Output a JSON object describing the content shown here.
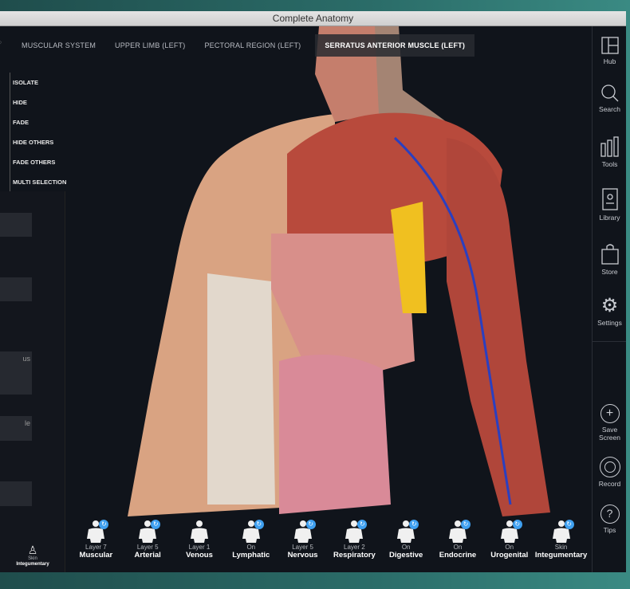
{
  "window": {
    "title": "Complete Anatomy"
  },
  "breadcrumbs": [
    "MUSCULAR SYSTEM",
    "UPPER LIMB (LEFT)",
    "PECTORAL REGION (LEFT)",
    "SERRATUS ANTERIOR MUSCLE (LEFT)"
  ],
  "context_menu": [
    "ISOLATE",
    "HIDE",
    "FADE",
    "HIDE OTHERS",
    "FADE OTHERS",
    "MULTI SELECTION"
  ],
  "left_panel": {
    "fragments": [
      "us",
      "le"
    ]
  },
  "right_sidebar": [
    {
      "label": "Hub",
      "icon": "hub-icon"
    },
    {
      "label": "Search",
      "icon": "search-icon"
    },
    {
      "label": "Tools",
      "icon": "tools-icon"
    },
    {
      "label": "Library",
      "icon": "library-icon"
    },
    {
      "label": "Store",
      "icon": "store-icon"
    },
    {
      "label": "Settings",
      "icon": "gear-icon"
    }
  ],
  "right_actions": [
    {
      "label": "Save Screen",
      "icon": "plus-icon"
    },
    {
      "label": "Record",
      "icon": "record-icon"
    },
    {
      "label": "Tips",
      "icon": "help-icon"
    }
  ],
  "systems": [
    {
      "layer": "Layer 7",
      "name": "Muscular",
      "badge": true
    },
    {
      "layer": "Layer 5",
      "name": "Arterial",
      "badge": true
    },
    {
      "layer": "Layer 1",
      "name": "Venous",
      "badge": false
    },
    {
      "layer": "On",
      "name": "Lymphatic",
      "badge": true
    },
    {
      "layer": "Layer 5",
      "name": "Nervous",
      "badge": true
    },
    {
      "layer": "Layer 2",
      "name": "Respiratory",
      "badge": true
    },
    {
      "layer": "On",
      "name": "Digestive",
      "badge": true
    },
    {
      "layer": "On",
      "name": "Endocrine",
      "badge": true
    },
    {
      "layer": "On",
      "name": "Urogenital",
      "badge": true
    },
    {
      "layer": "Skin",
      "name": "Integumentary",
      "badge": true
    }
  ],
  "left_skin": {
    "layer": "Skin",
    "name": "Integumentary"
  },
  "colors": {
    "accent": "#3fa0f0",
    "muscle": "#b84a3c",
    "skin": "#d9a382",
    "background": "#10141b"
  }
}
